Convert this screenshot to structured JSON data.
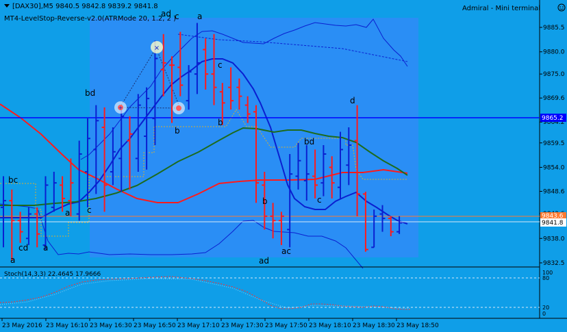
{
  "window": {
    "header": "[DAX30],M5  9840.5 9842.8 9839.2 9841.8",
    "indicator_label": "MT4-LevelStop-Reverse-v2.0(ATRMode 20, 1.2, 2 )",
    "mini_terminal": "Admiral - Mini terminal",
    "stoch_label": "Stoch(14,3,3) 22.4645 17.9666"
  },
  "colors": {
    "background": "#0f9ee8",
    "session_box": "#2a8ef5",
    "up_bar": "#0a1fd0",
    "down_bar": "#ff1a1a",
    "ma_fast": "#0a1fd0",
    "ma_slow": "#ff1a1a",
    "ma_mid": "#1d6b1d",
    "bands": "#0a1fd0",
    "stop_line": "#d8b030",
    "hline": "#0000ff",
    "price_line": "#ffffff",
    "stoch_main": "#ff3030",
    "stoch_signal": "#ffffff"
  },
  "chart_data": {
    "type": "candlestick",
    "y_ticks": [
      "9885.5",
      "9880.0",
      "9875.0",
      "9869.6",
      "9864.2",
      "9859.5",
      "9854.0",
      "9848.6",
      "9843.6",
      "9838.0",
      "9832.5"
    ],
    "x_ticks": [
      "23 May 2016",
      "23 May 16:10",
      "23 May 16:30",
      "23 May 16:50",
      "23 May 17:10",
      "23 May 17:30",
      "23 May 17:50",
      "23 May 18:10",
      "23 May 18:30",
      "23 May 18:50"
    ],
    "price_tags": {
      "horizontal_level": "9865.2",
      "bid": "9841.8",
      "ask": "9843.6"
    },
    "bars": [
      {
        "o": 9845.0,
        "h": 9852.0,
        "l": 9836.0,
        "c": 9846.5,
        "up": true
      },
      {
        "o": 9846.5,
        "h": 9849.0,
        "l": 9833.0,
        "c": 9842.0,
        "up": false
      },
      {
        "o": 9842.0,
        "h": 9844.0,
        "l": 9837.0,
        "c": 9839.5,
        "up": false
      },
      {
        "o": 9838.0,
        "h": 9845.0,
        "l": 9836.5,
        "c": 9843.5,
        "up": true
      },
      {
        "o": 9843.5,
        "h": 9845.0,
        "l": 9836.0,
        "c": 9839.0,
        "up": false
      },
      {
        "o": 9836.5,
        "h": 9852.0,
        "l": 9835.5,
        "c": 9850.0,
        "up": true
      },
      {
        "o": 9845.0,
        "h": 9853.0,
        "l": 9844.0,
        "c": 9850.5,
        "up": true
      },
      {
        "o": 9850.0,
        "h": 9852.0,
        "l": 9844.0,
        "c": 9847.0,
        "up": false
      },
      {
        "o": 9846.5,
        "h": 9856.0,
        "l": 9843.0,
        "c": 9850.5,
        "up": false
      },
      {
        "o": 9843.5,
        "h": 9860.0,
        "l": 9842.0,
        "c": 9857.0,
        "up": true
      },
      {
        "o": 9853.0,
        "h": 9865.0,
        "l": 9845.0,
        "c": 9860.5,
        "up": true
      },
      {
        "o": 9858.0,
        "h": 9868.0,
        "l": 9848.0,
        "c": 9864.5,
        "up": true
      },
      {
        "o": 9863.0,
        "h": 9867.5,
        "l": 9844.0,
        "c": 9850.0,
        "up": false
      },
      {
        "o": 9853.0,
        "h": 9863.0,
        "l": 9850.0,
        "c": 9857.5,
        "up": true
      },
      {
        "o": 9856.0,
        "h": 9868.0,
        "l": 9848.5,
        "c": 9865.5,
        "up": true
      },
      {
        "o": 9860.0,
        "h": 9865.5,
        "l": 9849.0,
        "c": 9861.5,
        "up": false
      },
      {
        "o": 9856.0,
        "h": 9870.5,
        "l": 9853.0,
        "c": 9868.0,
        "up": true
      },
      {
        "o": 9861.0,
        "h": 9872.0,
        "l": 9853.5,
        "c": 9869.5,
        "up": true
      },
      {
        "o": 9865.0,
        "h": 9882.5,
        "l": 9859.0,
        "c": 9878.5,
        "up": true
      },
      {
        "o": 9876.0,
        "h": 9884.0,
        "l": 9870.0,
        "c": 9877.5,
        "up": false
      },
      {
        "o": 9877.0,
        "h": 9879.0,
        "l": 9864.0,
        "c": 9877.0,
        "up": false
      },
      {
        "o": 9876.5,
        "h": 9884.5,
        "l": 9870.0,
        "c": 9872.5,
        "up": false
      },
      {
        "o": 9869.0,
        "h": 9877.0,
        "l": 9867.0,
        "c": 9875.5,
        "up": true
      },
      {
        "o": 9875.0,
        "h": 9886.5,
        "l": 9870.5,
        "c": 9877.5,
        "up": true
      },
      {
        "o": 9880.5,
        "h": 9883.0,
        "l": 9871.5,
        "c": 9875.0,
        "up": false
      },
      {
        "o": 9875.0,
        "h": 9884.0,
        "l": 9868.0,
        "c": 9872.0,
        "up": false
      },
      {
        "o": 9871.0,
        "h": 9873.0,
        "l": 9863.5,
        "c": 9868.5,
        "up": false
      },
      {
        "o": 9872.0,
        "h": 9876.5,
        "l": 9867.0,
        "c": 9869.0,
        "up": false
      },
      {
        "o": 9872.0,
        "h": 9874.0,
        "l": 9867.0,
        "c": 9870.0,
        "up": false
      },
      {
        "o": 9868.0,
        "h": 9870.0,
        "l": 9864.0,
        "c": 9866.0,
        "up": false
      },
      {
        "o": 9866.5,
        "h": 9868.0,
        "l": 9846.0,
        "c": 9850.5,
        "up": false
      },
      {
        "o": 9850.0,
        "h": 9853.0,
        "l": 9840.0,
        "c": 9843.0,
        "up": false
      },
      {
        "o": 9843.0,
        "h": 9846.0,
        "l": 9838.0,
        "c": 9842.0,
        "up": false
      },
      {
        "o": 9842.0,
        "h": 9844.0,
        "l": 9836.5,
        "c": 9843.0,
        "up": false
      },
      {
        "o": 9840.0,
        "h": 9857.0,
        "l": 9836.0,
        "c": 9852.5,
        "up": true
      },
      {
        "o": 9852.0,
        "h": 9859.5,
        "l": 9849.0,
        "c": 9855.5,
        "up": true
      },
      {
        "o": 9851.0,
        "h": 9859.0,
        "l": 9846.5,
        "c": 9852.5,
        "up": true
      },
      {
        "o": 9852.0,
        "h": 9858.0,
        "l": 9847.0,
        "c": 9850.0,
        "up": false
      },
      {
        "o": 9850.5,
        "h": 9859.0,
        "l": 9847.5,
        "c": 9857.0,
        "up": true
      },
      {
        "o": 9854.0,
        "h": 9856.5,
        "l": 9847.0,
        "c": 9850.5,
        "up": false
      },
      {
        "o": 9849.5,
        "h": 9862.0,
        "l": 9847.0,
        "c": 9858.0,
        "up": true
      },
      {
        "o": 9854.5,
        "h": 9863.0,
        "l": 9850.0,
        "c": 9859.0,
        "up": true
      },
      {
        "o": 9860.0,
        "h": 9868.0,
        "l": 9843.0,
        "c": 9848.0,
        "up": false
      },
      {
        "o": 9848.0,
        "h": 9848.5,
        "l": 9835.0,
        "c": 9835.5,
        "up": false
      },
      {
        "o": 9836.0,
        "h": 9844.5,
        "l": 9836.0,
        "c": 9843.0,
        "up": true
      },
      {
        "o": 9843.5,
        "h": 9845.5,
        "l": 9839.5,
        "c": 9842.5,
        "up": true
      },
      {
        "o": 9842.5,
        "h": 9843.0,
        "l": 9838.5,
        "c": 9839.5,
        "up": false
      },
      {
        "o": 9839.5,
        "h": 9843.0,
        "l": 9839.0,
        "c": 9841.5,
        "up": true
      }
    ],
    "ma_fast": [
      9841.0,
      9840.5,
      9840.5,
      9841.0,
      9842.0,
      9844.0,
      9846.0,
      9849.0,
      9852.0,
      9855.0,
      9857.5,
      9860.0,
      9862.0,
      9864.5,
      9867.0,
      9869.5,
      9871.5,
      9873.5,
      9875.5,
      9876.5,
      9877.0,
      9877.0,
      9876.5
    ],
    "ma_slow": [
      9868.0,
      9864.0,
      9860.5,
      9857.0,
      9853.5,
      9850.5,
      9849.0,
      9847.5,
      9846.0,
      9845.0,
      9844.5,
      9844.0,
      9844.0,
      9844.0,
      9845.0,
      9846.5,
      9847.5,
      9848.0,
      9848.5,
      9848.5,
      9848.5,
      9848.5,
      9848.5
    ],
    "ma_mid": [
      9843.5,
      9844.0,
      9844.5,
      9845.0,
      9846.0,
      9847.5,
      9849.5,
      9852.0,
      9855.0,
      9857.5,
      9860.0,
      9861.5,
      9862.0,
      9861.5,
      9861.0,
      9860.5,
      9859.5,
      9857.5,
      9854.0,
      9852.5
    ]
  },
  "wave_labels": [
    {
      "text": "bc"
    },
    {
      "text": "cd"
    },
    {
      "text": "a"
    },
    {
      "text": "a"
    },
    {
      "text": "a"
    },
    {
      "text": "bd"
    },
    {
      "text": "c"
    },
    {
      "text": "ad"
    },
    {
      "text": "c"
    },
    {
      "text": "a"
    },
    {
      "text": "b"
    },
    {
      "text": "c"
    },
    {
      "text": "b"
    },
    {
      "text": "b"
    },
    {
      "text": "ad"
    },
    {
      "text": "ac"
    },
    {
      "text": "bd"
    },
    {
      "text": "c"
    },
    {
      "text": "d"
    }
  ],
  "stoch": {
    "levels": [
      "100",
      "80",
      "20",
      "0"
    ]
  }
}
